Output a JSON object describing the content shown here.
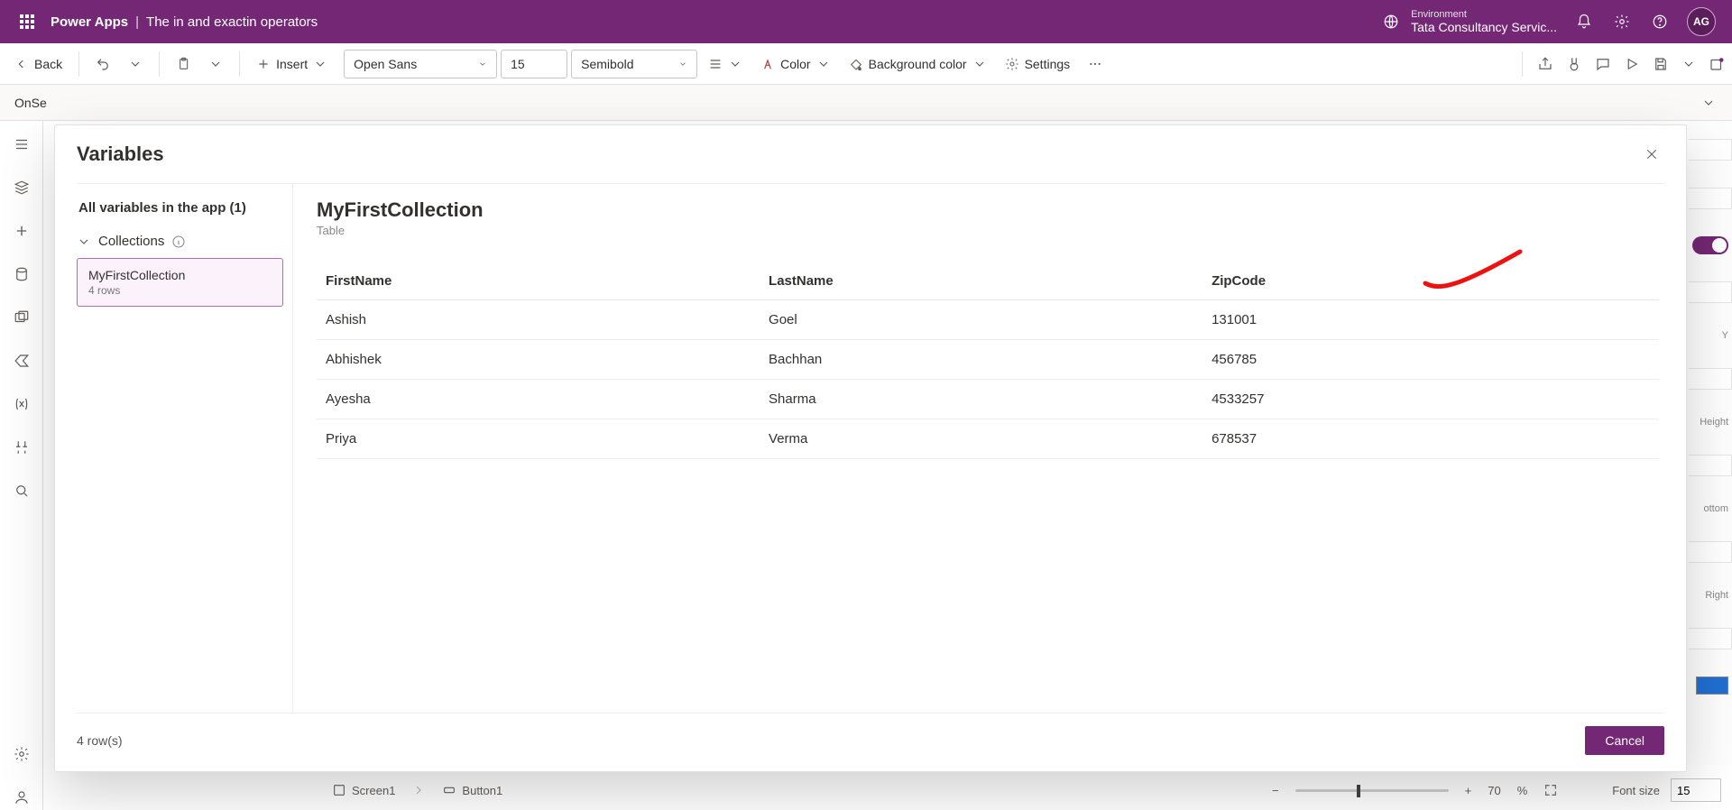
{
  "topbar": {
    "app_name": "Power Apps",
    "separator": "|",
    "page_title": "The in and exactin operators",
    "env_label": "Environment",
    "env_name": "Tata Consultancy Servic...",
    "avatar_initials": "AG"
  },
  "cmdbar": {
    "back": "Back",
    "insert": "Insert",
    "font_family": "Open Sans",
    "font_size": "15",
    "font_weight": "Semibold",
    "color_label": "Color",
    "bg_label": "Background color",
    "settings_label": "Settings"
  },
  "formula": {
    "property": "OnSe"
  },
  "modal": {
    "title": "Variables",
    "all_vars_label": "All variables in the app (1)",
    "group_label": "Collections",
    "selected": {
      "name": "MyFirstCollection",
      "meta": "4 rows"
    },
    "detail_title": "MyFirstCollection",
    "detail_type": "Table",
    "columns": [
      "FirstName",
      "LastName",
      "ZipCode"
    ],
    "rows": [
      {
        "FirstName": "Ashish",
        "LastName": "Goel",
        "ZipCode": "131001"
      },
      {
        "FirstName": "Abhishek",
        "LastName": "Bachhan",
        "ZipCode": "456785"
      },
      {
        "FirstName": "Ayesha",
        "LastName": "Sharma",
        "ZipCode": "4533257"
      },
      {
        "FirstName": "Priya",
        "LastName": "Verma",
        "ZipCode": "678537"
      }
    ],
    "row_count_label": "4 row(s)",
    "cancel_label": "Cancel"
  },
  "bottom": {
    "crumb1": "Screen1",
    "crumb2": "Button1",
    "zoom_value": "70",
    "zoom_unit": "%",
    "prop_label": "Font size",
    "prop_value": "15"
  },
  "rightstrip": {
    "l1": "Y",
    "l2": "Height",
    "l3": "ottom",
    "l4": "Right"
  }
}
